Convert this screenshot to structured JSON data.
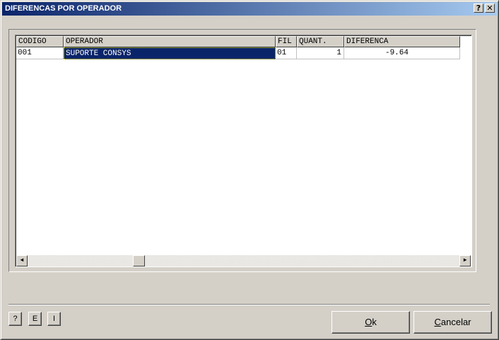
{
  "window": {
    "title": "DIFERENCAS POR OPERADOR",
    "help_glyph": "?",
    "close_glyph": "✕"
  },
  "grid": {
    "columns": [
      "CODIGO",
      "OPERADOR",
      "FIL",
      "QUANT.",
      "DIFERENCA"
    ],
    "rows": [
      {
        "codigo": "001",
        "operador": "SUPORTE CONSYS",
        "fil": "01",
        "quant": "1",
        "diferenca": "-9.64"
      }
    ],
    "selected_cell": "operador"
  },
  "scrollbar": {
    "left_arrow": "◄",
    "right_arrow": "►"
  },
  "buttons": {
    "help": "?",
    "e": "E",
    "i": "I",
    "ok_mnemonic": "O",
    "ok_rest": "k",
    "cancel_mnemonic": "C",
    "cancel_rest": "ancelar"
  },
  "colors": {
    "titlebar_start": "#0a246a",
    "titlebar_end": "#a6caf0",
    "selection": "#0a246a",
    "face": "#d4d0c8"
  }
}
